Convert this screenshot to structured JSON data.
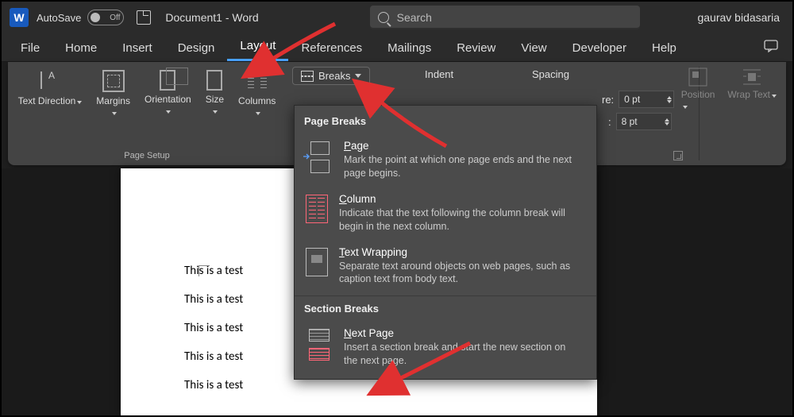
{
  "titlebar": {
    "autosave_label": "AutoSave",
    "autosave_state": "Off",
    "doc_title": "Document1 - Word",
    "search_placeholder": "Search",
    "user_name": "gaurav bidasaria"
  },
  "tabs": [
    "File",
    "Home",
    "Insert",
    "Design",
    "Layout",
    "References",
    "Mailings",
    "Review",
    "View",
    "Developer",
    "Help"
  ],
  "active_tab": "Layout",
  "ribbon": {
    "page_setup": {
      "text_direction": "Text Direction",
      "margins": "Margins",
      "orientation": "Orientation",
      "size": "Size",
      "columns": "Columns",
      "group_label": "Page Setup"
    },
    "breaks_label": "Breaks",
    "indent_label": "Indent",
    "spacing_label": "Spacing",
    "before_short": "re:",
    "after_short": ":",
    "before_val": "0 pt",
    "after_val": "8 pt",
    "position": "Position",
    "wrap_text": "Wrap Text"
  },
  "breaks_menu": {
    "page_breaks_header": "Page Breaks",
    "items_page": [
      {
        "title_pre": "",
        "u": "P",
        "title_post": "age",
        "desc": "Mark the point at which one page ends and the next page begins."
      },
      {
        "title_pre": "",
        "u": "C",
        "title_post": "olumn",
        "desc": "Indicate that the text following the column break will begin in the next column."
      },
      {
        "title_pre": "",
        "u": "T",
        "title_post": "ext Wrapping",
        "desc": "Separate text around objects on web pages, such as caption text from body text."
      }
    ],
    "section_breaks_header": "Section Breaks",
    "items_section": [
      {
        "title_pre": "",
        "u": "N",
        "title_post": "ext Page",
        "desc": "Insert a section break and start the new section on the next page."
      }
    ]
  },
  "document": {
    "lines": [
      "This is a test",
      "This is a test",
      "This is a test",
      "This is a test",
      "This is a test"
    ]
  }
}
